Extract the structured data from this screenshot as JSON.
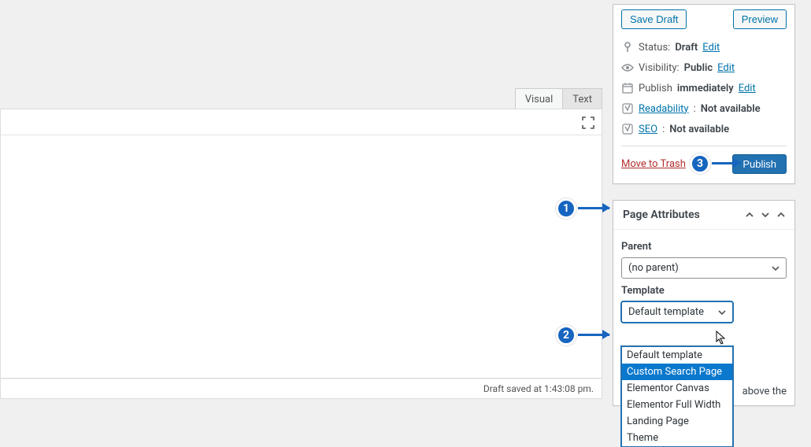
{
  "editor": {
    "tabs": {
      "visual": "Visual",
      "text": "Text"
    },
    "footer_status": "Draft saved at 1:43:08 pm."
  },
  "publish_box": {
    "save_draft": "Save Draft",
    "preview": "Preview",
    "status_label": "Status:",
    "status_value": "Draft",
    "status_edit": "Edit",
    "visibility_label": "Visibility:",
    "visibility_value": "Public",
    "visibility_edit": "Edit",
    "publish_label": "Publish",
    "publish_value": "immediately",
    "publish_edit": "Edit",
    "readability_label": "Readability",
    "readability_value": "Not available",
    "seo_label": "SEO",
    "seo_value": "Not available",
    "trash": "Move to Trash",
    "publish_btn": "Publish"
  },
  "page_attributes": {
    "title": "Page Attributes",
    "parent_label": "Parent",
    "parent_value": "(no parent)",
    "template_label": "Template",
    "template_value": "Default template",
    "template_options": [
      "Default template",
      "Custom Search Page",
      "Elementor Canvas",
      "Elementor Full Width",
      "Landing Page",
      "Theme"
    ],
    "note_fragment": "above the"
  },
  "annotations": {
    "b1": "1",
    "b2": "2",
    "b3": "3"
  }
}
